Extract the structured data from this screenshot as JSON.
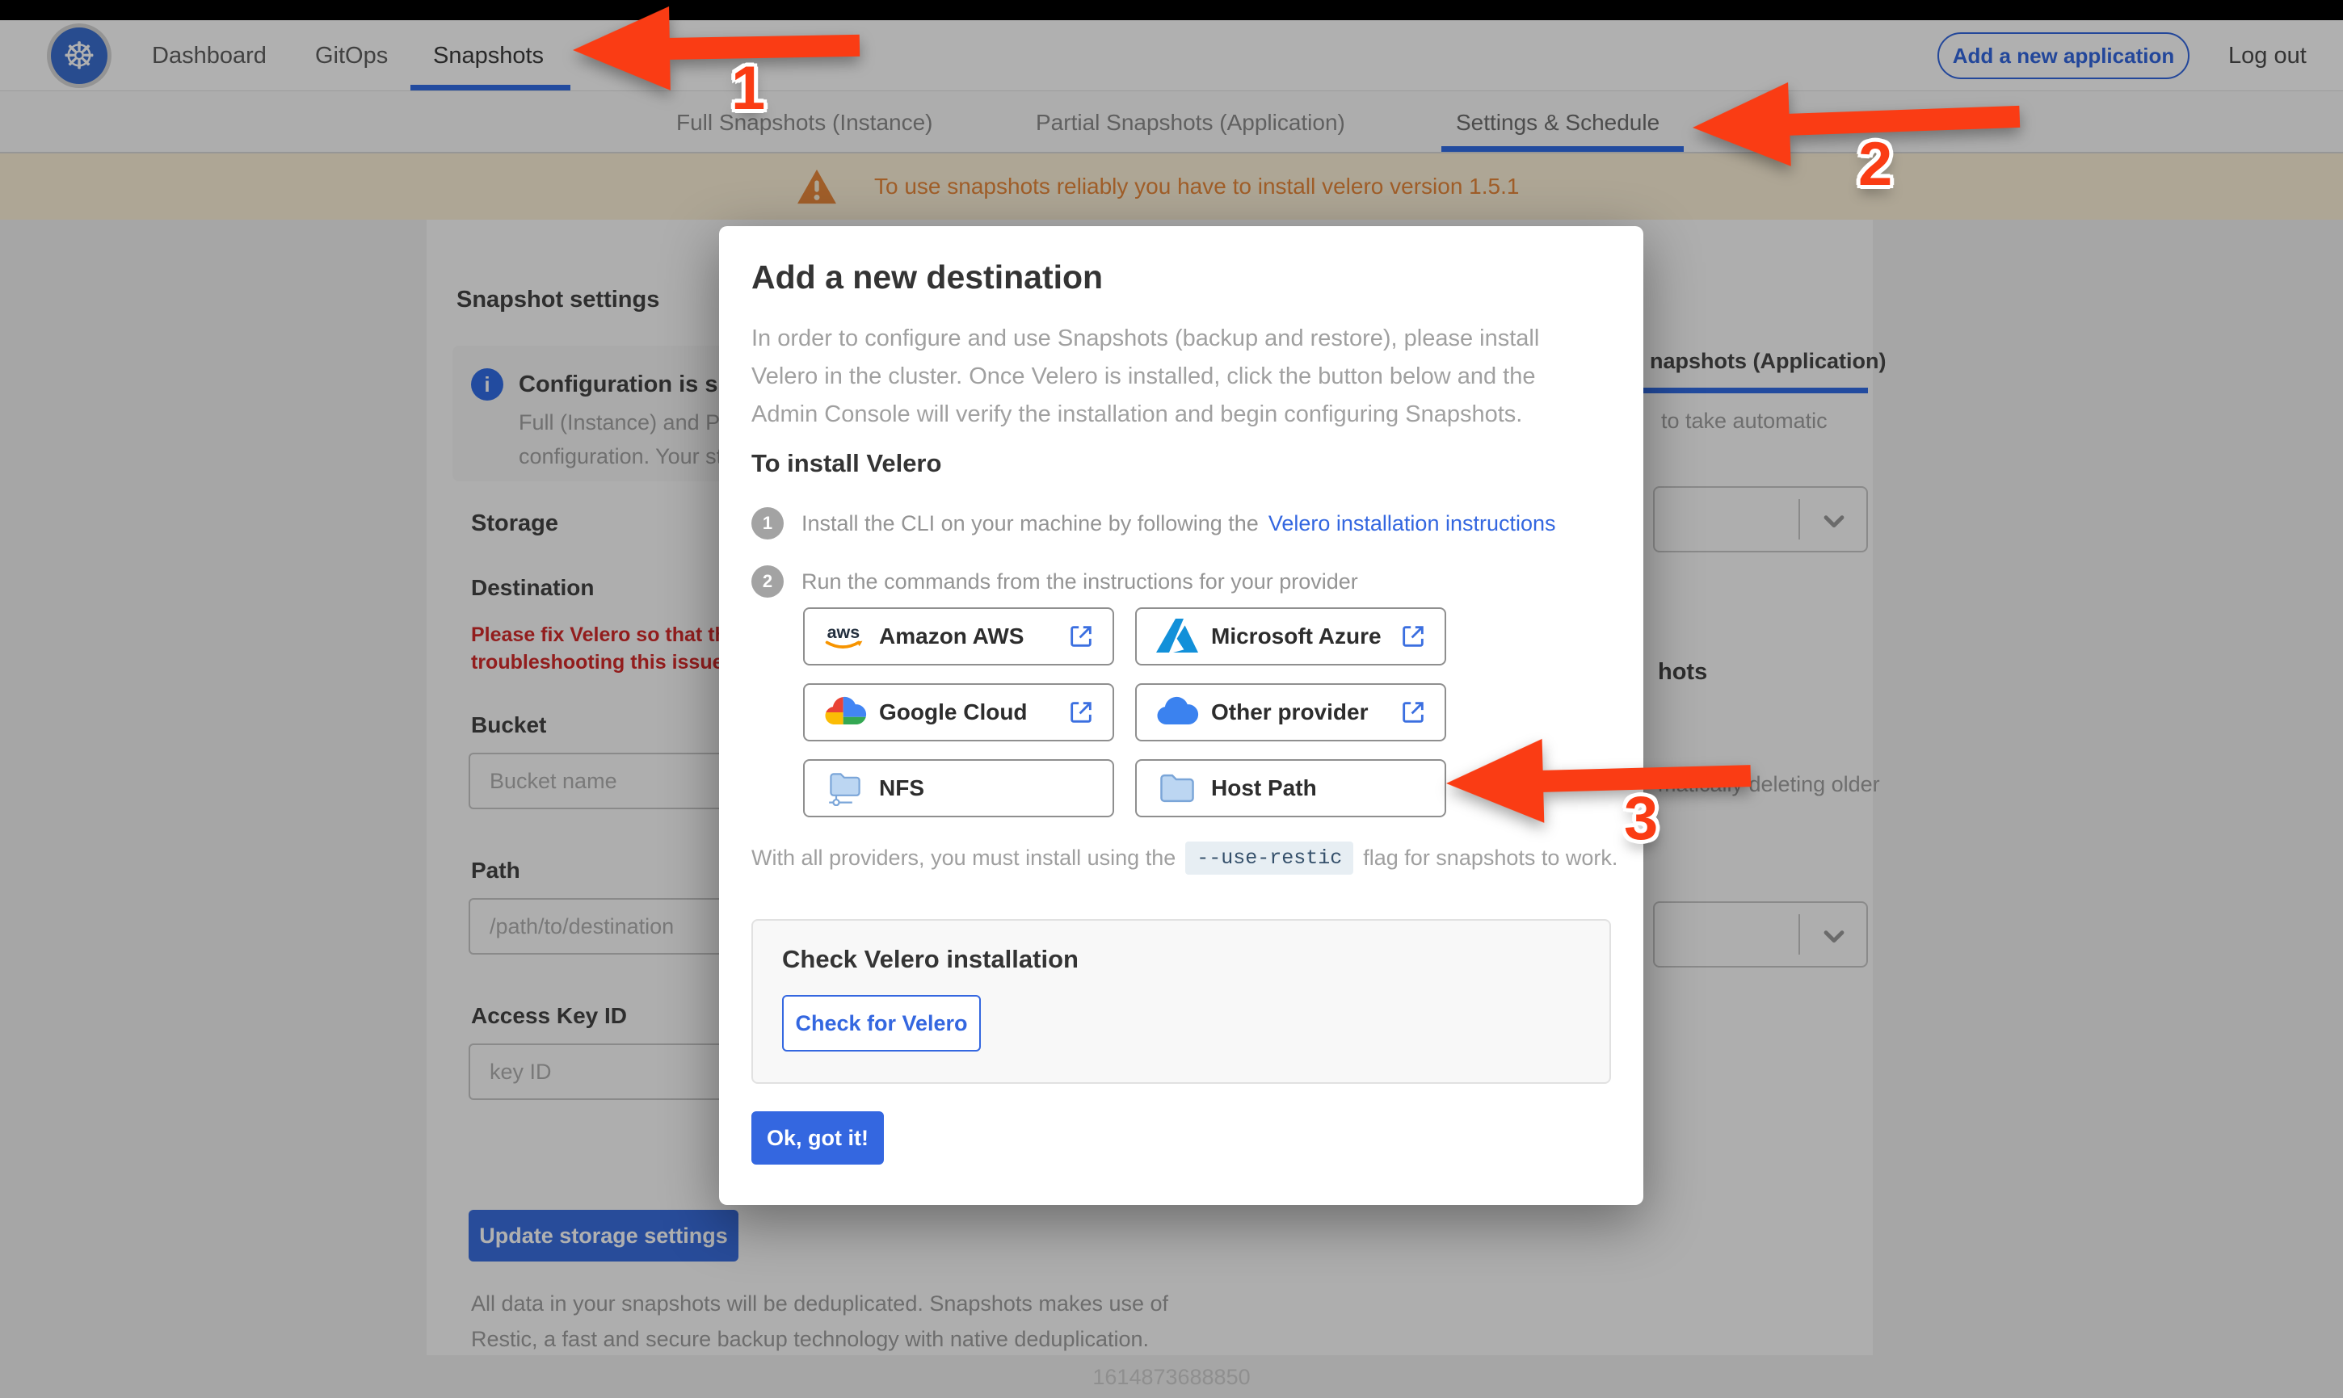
{
  "topnav": {
    "items": [
      {
        "label": "Dashboard"
      },
      {
        "label": "GitOps"
      },
      {
        "label": "Snapshots"
      }
    ],
    "add_app_label": "Add a new application",
    "logout_label": "Log out"
  },
  "subtabs": {
    "items": [
      {
        "label": "Full Snapshots (Instance)"
      },
      {
        "label": "Partial Snapshots (Application)"
      },
      {
        "label": "Settings & Schedule"
      }
    ]
  },
  "banner": {
    "text": "To use snapshots reliably you have to install velero version 1.5.1"
  },
  "settings_page": {
    "title": "Snapshot settings",
    "info_card": {
      "title": "Configuration is sh",
      "line1": "Full (Instance) and Parti",
      "line2": "configuration. Your stor"
    },
    "storage_heading": "Storage",
    "destination_heading": "Destination",
    "error_line1": "Please fix Velero so that th",
    "error_line2": "troubleshooting this issue",
    "fields": [
      {
        "label": "Bucket",
        "placeholder": "Bucket name"
      },
      {
        "label": "Path",
        "placeholder": "/path/to/destination"
      },
      {
        "label": "Access Key ID",
        "placeholder": "key ID"
      }
    ],
    "update_button": "Update storage settings",
    "dedupe_text": "All data in your snapshots will be deduplicated. Snapshots makes use of Restic, a fast and secure backup technology with native deduplication.",
    "right_column": {
      "tab_fragment": "napshots (Application)",
      "auto_fragment": "to take automatic",
      "heading_fragment": "hots",
      "older_fragment": "matically deleting older"
    }
  },
  "modal": {
    "title": "Add a new destination",
    "description": "In order to configure and use Snapshots (backup and restore), please install Velero in the cluster. Once Velero is installed, click the button below and the Admin Console will verify the installation and begin configuring Snapshots.",
    "install_heading": "To install Velero",
    "steps": [
      {
        "num": "1",
        "text": "Install the CLI on your machine by following the",
        "link": "Velero installation instructions"
      },
      {
        "num": "2",
        "text": "Run the commands from the instructions for your provider",
        "link": ""
      }
    ],
    "providers": [
      {
        "label": "Amazon AWS"
      },
      {
        "label": "Microsoft Azure"
      },
      {
        "label": "Google Cloud"
      },
      {
        "label": "Other provider"
      },
      {
        "label": "NFS"
      },
      {
        "label": "Host Path"
      }
    ],
    "restic_note_pre": "With all providers, you must install using the",
    "restic_flag": "--use-restic",
    "restic_note_post": "flag for snapshots to work.",
    "check_heading": "Check Velero installation",
    "check_button": "Check for Velero",
    "ok_button": "Ok, got it!"
  },
  "annotations": {
    "labels": [
      {
        "num": "1"
      },
      {
        "num": "2"
      },
      {
        "num": "3"
      }
    ]
  },
  "footer": {
    "timestamp": "1614873688850"
  },
  "colors": {
    "primary_blue": "#326de6",
    "link_blue": "#3467e0",
    "arrow_red": "#fa3c14",
    "banner_orange": "#e8893c",
    "banner_bg": "#fdf1d8",
    "error_red": "#d42b2b"
  }
}
